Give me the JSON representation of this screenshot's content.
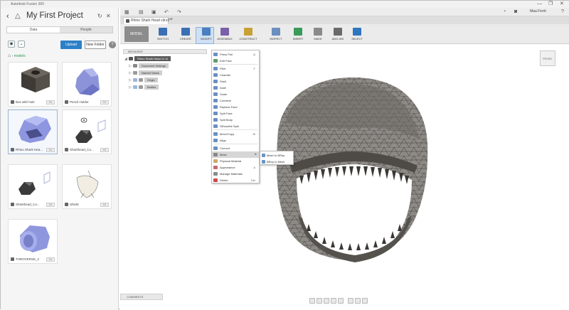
{
  "window": {
    "title": "Autodesk Fusion 360",
    "controls": [
      "—",
      "❐",
      "✕"
    ]
  },
  "data_panel": {
    "project_title": "My First Project",
    "tabs": [
      {
        "label": "Data",
        "active": true
      },
      {
        "label": "People",
        "active": false
      }
    ],
    "upload_label": "Upload",
    "new_folder_label": "New Folder",
    "help_label": "?",
    "breadcrumb": "models",
    "items": [
      {
        "name": "Box with hole",
        "version": "V1",
        "selected": false,
        "shape": "box"
      },
      {
        "name": "Pencil Holder",
        "version": "V1",
        "selected": false,
        "shape": "pencil"
      },
      {
        "name": "Rhino Shark Hea...",
        "version": "V1",
        "selected": true,
        "shape": "shark"
      },
      {
        "name": "Sharkhead_Co...",
        "version": "V1",
        "selected": false,
        "shape": "sharkdark"
      },
      {
        "name": "Sharkhead_Co...",
        "version": "V1",
        "selected": false,
        "shape": "sharkdark2"
      },
      {
        "name": "Shield",
        "version": "V1",
        "selected": false,
        "shape": "shield"
      },
      {
        "name": "THROVERSE_2",
        "version": "V1",
        "selected": false,
        "shape": "cylinder"
      }
    ]
  },
  "topbar": {
    "user_name": "Maa Ferrit",
    "icons": [
      "grid-icon",
      "file-icon",
      "save-icon",
      "undo-icon",
      "redo-icon"
    ]
  },
  "document_tab": {
    "label": "Rhino Shark Head v1 v2*",
    "close": "✕",
    "new_tab": "+"
  },
  "toolbar": {
    "workspace_label": "MODEL",
    "groups": [
      {
        "label": "SKETCH",
        "color": "#3a6fb5"
      },
      {
        "label": "CREATE",
        "color": "#3a6fb5"
      },
      {
        "label": "MODIFY",
        "color": "#4a7fc0"
      },
      {
        "label": "ASSEMBLE",
        "color": "#7a5fa8"
      },
      {
        "label": "CONSTRUCT",
        "color": "#c8a035"
      },
      {
        "label": "INSPECT",
        "color": "#6b8fbf"
      },
      {
        "label": "INSERT",
        "color": "#3a9a5a"
      },
      {
        "label": "MAKE",
        "color": "#8a8a8a"
      },
      {
        "label": "ADD-INS",
        "color": "#6a6a6a"
      },
      {
        "label": "SELECT",
        "color": "#2f76c0"
      }
    ]
  },
  "browser": {
    "header": "BROWSER",
    "root_label": "Rhino Shark Head v1 v2",
    "nodes": [
      {
        "label": "Document Settings"
      },
      {
        "label": "Named Views"
      },
      {
        "label": "Origin"
      },
      {
        "label": "Bodies"
      }
    ]
  },
  "modify_menu": {
    "items": [
      {
        "label": "Press Pull",
        "key": "Q",
        "color": "#6a8fc4"
      },
      {
        "label": "Edit Face",
        "key": "",
        "color": "#5f9a6a"
      },
      {
        "label": "Fillet",
        "key": "F",
        "color": "#6a8fc4"
      },
      {
        "label": "Chamfer",
        "key": "",
        "color": "#6a8fc4"
      },
      {
        "label": "Shell",
        "key": "",
        "color": "#6a8fc4"
      },
      {
        "label": "Draft",
        "key": "",
        "color": "#6a8fc4"
      },
      {
        "label": "Scale",
        "key": "",
        "color": "#6a8fc4"
      },
      {
        "label": "Combine",
        "key": "",
        "color": "#6a8fc4"
      },
      {
        "label": "Replace Face",
        "key": "",
        "color": "#6a8fc4"
      },
      {
        "label": "Split Face",
        "key": "",
        "color": "#6a8fc4"
      },
      {
        "label": "Split Body",
        "key": "",
        "color": "#6a8fc4"
      },
      {
        "label": "Silhouette Split",
        "key": "",
        "color": "#6a8fc4"
      },
      {
        "label": "Move/Copy",
        "key": "M",
        "color": "#6a8fc4"
      },
      {
        "label": "Align",
        "key": "",
        "color": "#6a8fc4"
      },
      {
        "label": "Convert",
        "key": "",
        "color": "#6a8fc4"
      },
      {
        "label": "Mesh",
        "key": "",
        "color": "#888888",
        "has_submenu": true
      },
      {
        "label": "Physical Material",
        "key": "",
        "color": "#c9a96a"
      },
      {
        "label": "Appearance",
        "key": "A",
        "color": "#c96a6a"
      },
      {
        "label": "Manage Materials",
        "key": "",
        "color": "#8a8a8a"
      },
      {
        "label": "Delete",
        "key": "Del",
        "color": "#c94a4a"
      }
    ],
    "mesh_submenu": [
      {
        "label": "Mesh to BRep"
      },
      {
        "label": "BRep to Mesh"
      }
    ]
  },
  "viewcube_label": "FRONT",
  "comments_label": "COMMENTS"
}
